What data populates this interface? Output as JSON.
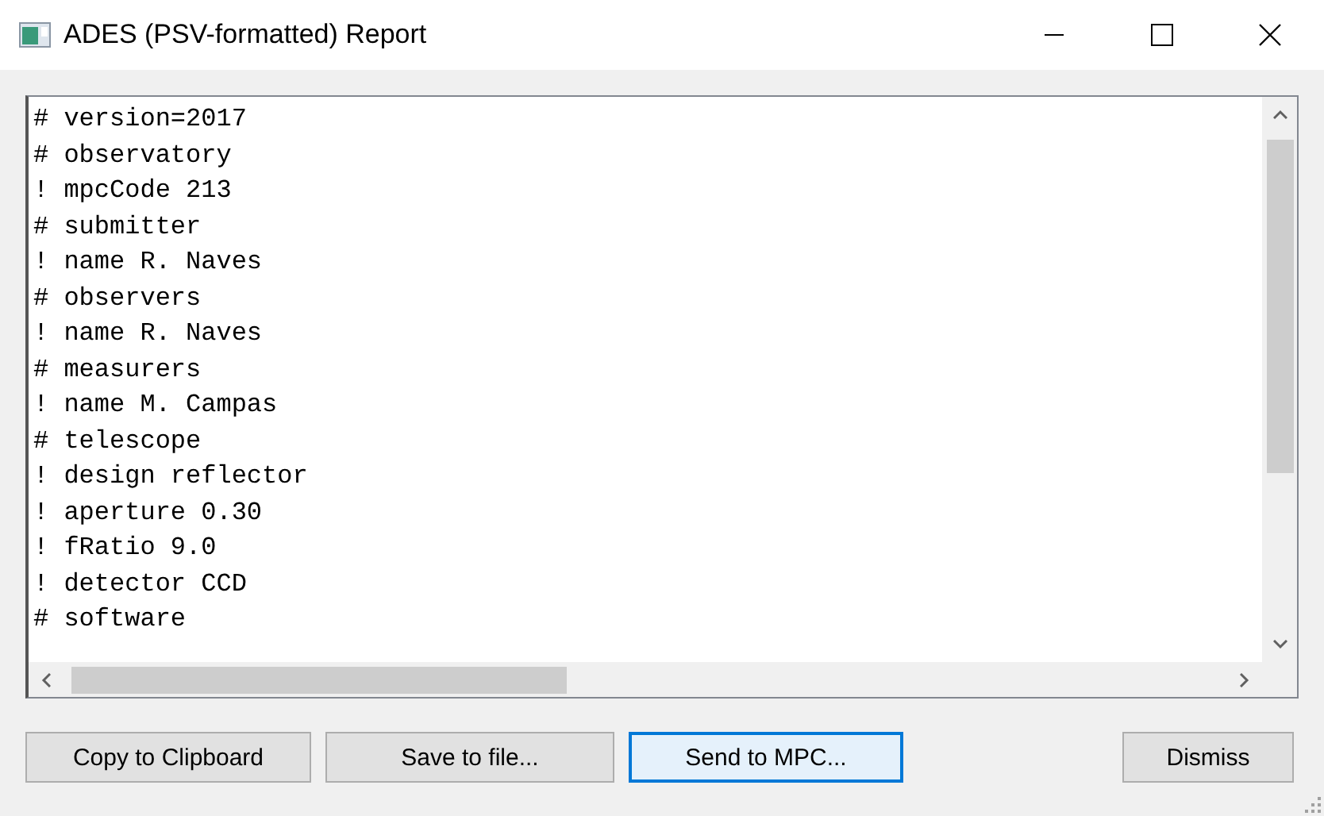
{
  "window": {
    "title": "ADES (PSV-formatted) Report"
  },
  "report": {
    "lines": [
      "# version=2017",
      "# observatory",
      "! mpcCode 213",
      "# submitter",
      "! name R. Naves",
      "# observers",
      "! name R. Naves",
      "# measurers",
      "! name M. Campas",
      "# telescope",
      "! design reflector",
      "! aperture 0.30",
      "! fRatio 9.0",
      "! detector CCD",
      "# software"
    ]
  },
  "buttons": [
    {
      "label": "Copy to Clipboard",
      "default": false
    },
    {
      "label": "Save to file...",
      "default": false
    },
    {
      "label": "Send to MPC...",
      "default": true
    },
    {
      "label": "Dismiss",
      "default": false
    }
  ]
}
